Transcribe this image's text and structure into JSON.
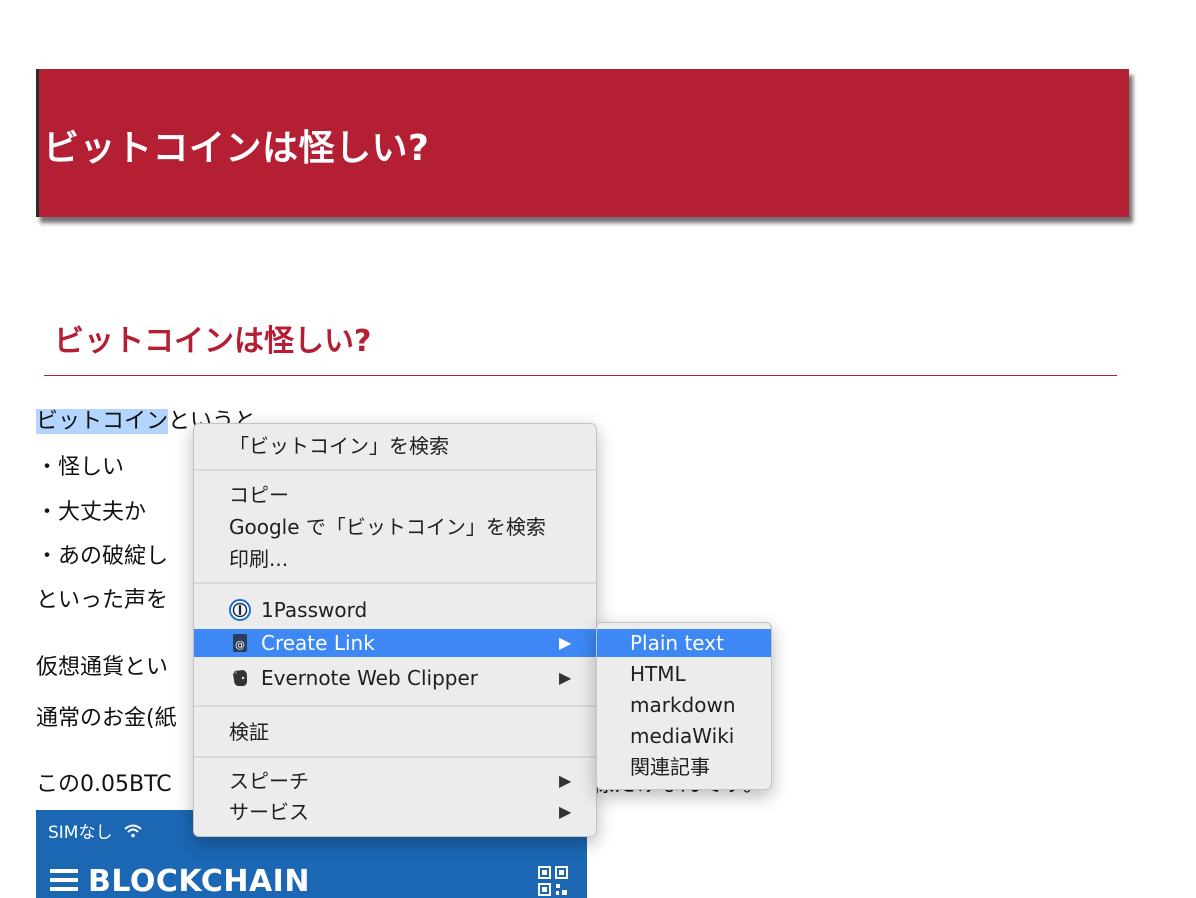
{
  "banner": {
    "title": "ビットコインは怪しい?"
  },
  "section": {
    "heading": "ビットコインは怪しい?"
  },
  "article": {
    "line1_selected": "ビットコイン",
    "line1_rest": "というと",
    "line2": "・怪しい",
    "line3": "・大丈夫か",
    "line4": "・あの破綻し",
    "line5": "といった声を",
    "line6": "仮想通貨とい",
    "line7": "通常のお金(紙",
    "line8_start": "この0.05BTC",
    "line8_end": "様だけなんです。"
  },
  "phone": {
    "status": "SIMなし",
    "wifi_icon": "wifi-icon",
    "brand": "BLOCKCHAIN",
    "menu_icon": "hamburger-icon",
    "scan_icon": "qr-code-icon"
  },
  "context_menu": {
    "search_selection": "「ビットコイン」を検索",
    "copy": "コピー",
    "google_search": "Google で「ビットコイン」を検索",
    "print": "印刷...",
    "onepassword": "1Password",
    "create_link": "Create Link",
    "evernote": "Evernote Web Clipper",
    "inspect": "検証",
    "speech": "スピーチ",
    "services": "サービス",
    "submenu_arrow": "▶",
    "highlight_color": "#3d88f4"
  },
  "submenu": {
    "items": [
      "Plain text",
      "HTML",
      "markdown",
      "mediaWiki",
      "関連記事"
    ]
  },
  "colors": {
    "brand_red": "#b51f33",
    "selection": "#b3d4fd",
    "phone_blue": "#1b67b4"
  }
}
